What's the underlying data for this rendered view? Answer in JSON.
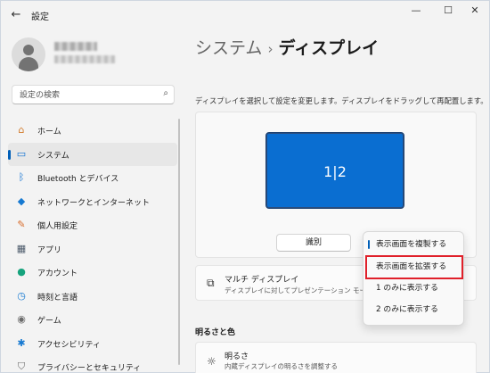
{
  "window": {
    "title": "設定",
    "back_glyph": "←",
    "minimize_glyph": "—",
    "maximize_glyph": "☐",
    "close_glyph": "✕"
  },
  "search": {
    "placeholder": "設定の検索",
    "icon": "search-icon"
  },
  "nav": [
    {
      "label": "ホーム",
      "icon": "home-icon",
      "glyph": "⌂",
      "color": "#d27b2c"
    },
    {
      "label": "システム",
      "icon": "monitor-icon",
      "glyph": "▭",
      "color": "#0a6ed1",
      "active": true
    },
    {
      "label": "Bluetooth とデバイス",
      "icon": "bluetooth-icon",
      "glyph": "ᛒ",
      "color": "#0a6ed1"
    },
    {
      "label": "ネットワークとインターネット",
      "icon": "wifi-icon",
      "glyph": "◆",
      "color": "#1679d1"
    },
    {
      "label": "個人用設定",
      "icon": "brush-icon",
      "glyph": "✎",
      "color": "#d76b2a"
    },
    {
      "label": "アプリ",
      "icon": "apps-icon",
      "glyph": "▦",
      "color": "#4d5b6b"
    },
    {
      "label": "アカウント",
      "icon": "person-icon",
      "glyph": "●",
      "color": "#16a37d"
    },
    {
      "label": "時刻と言語",
      "icon": "globe-clock-icon",
      "glyph": "◷",
      "color": "#1679d1"
    },
    {
      "label": "ゲーム",
      "icon": "gamepad-icon",
      "glyph": "◉",
      "color": "#6b6b6b"
    },
    {
      "label": "アクセシビリティ",
      "icon": "accessibility-icon",
      "glyph": "✱",
      "color": "#1679d1"
    },
    {
      "label": "プライバシーとセキュリティ",
      "icon": "shield-icon",
      "glyph": "⛉",
      "color": "#6b6b6b"
    }
  ],
  "breadcrumb": {
    "parent": "システム",
    "separator": "›",
    "current": "ディスプレイ"
  },
  "arrangement": {
    "hint": "ディスプレイを選択して設定を変更します。ディスプレイをドラッグして再配置します。",
    "monitor_label": "1|2",
    "identify_label": "識別"
  },
  "multi_display": {
    "title": "マルチ ディスプレイ",
    "subtitle": "ディスプレイに対してプレゼンテーション モードを選択"
  },
  "section_brightness": "明るさと色",
  "brightness": {
    "title": "明るさ",
    "subtitle": "内蔵ディスプレイの明るさを調整する"
  },
  "dropdown": {
    "items": [
      {
        "label": "表示画面を複製する",
        "selected": true
      },
      {
        "label": "表示画面を拡張する",
        "highlighted": true
      },
      {
        "label": "1 のみに表示する"
      },
      {
        "label": "2 のみに表示する"
      }
    ]
  },
  "colors": {
    "accent": "#005fb8",
    "monitor": "#0a6ed1",
    "highlight_box": "#e0202a"
  }
}
